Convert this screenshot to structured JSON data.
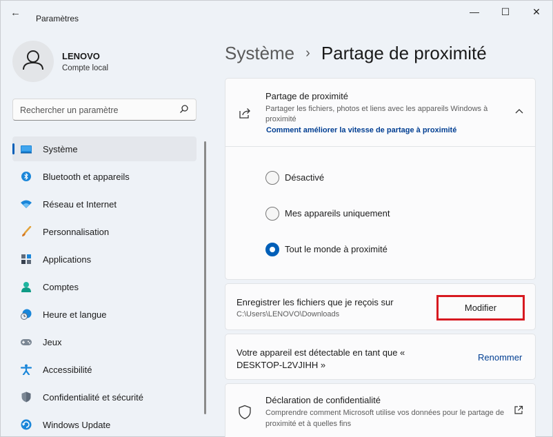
{
  "window": {
    "title": "Paramètres",
    "back_glyph": "←",
    "controls": {
      "minimize": "—",
      "maximize": "☐",
      "close": "✕"
    }
  },
  "profile": {
    "name": "LENOVO",
    "account_type": "Compte local",
    "icon": "user-avatar-icon"
  },
  "search": {
    "placeholder": "Rechercher un paramètre",
    "icon": "search-icon"
  },
  "sidebar": {
    "items": [
      {
        "label": "Système",
        "icon": "monitor-icon",
        "active": true
      },
      {
        "label": "Bluetooth et appareils",
        "icon": "bluetooth-icon"
      },
      {
        "label": "Réseau et Internet",
        "icon": "wifi-icon"
      },
      {
        "label": "Personnalisation",
        "icon": "brush-icon"
      },
      {
        "label": "Applications",
        "icon": "apps-icon"
      },
      {
        "label": "Comptes",
        "icon": "person-icon"
      },
      {
        "label": "Heure et langue",
        "icon": "clock-globe-icon"
      },
      {
        "label": "Jeux",
        "icon": "gamepad-icon"
      },
      {
        "label": "Accessibilité",
        "icon": "accessibility-icon"
      },
      {
        "label": "Confidentialité et sécurité",
        "icon": "shield-icon"
      },
      {
        "label": "Windows Update",
        "icon": "update-icon"
      }
    ]
  },
  "breadcrumb": {
    "parent": "Système",
    "separator": "›",
    "current": "Partage de proximité"
  },
  "nearby_card": {
    "title": "Partage de proximité",
    "description": "Partager les fichiers, photos et liens avec les appareils Windows à proximité",
    "link": "Comment améliorer la vitesse de partage à proximité",
    "options": [
      {
        "label": "Désactivé",
        "checked": false
      },
      {
        "label": "Mes appareils uniquement",
        "checked": false
      },
      {
        "label": "Tout le monde à proximité",
        "checked": true
      }
    ]
  },
  "save_card": {
    "title": "Enregistrer les fichiers que je reçois sur",
    "path": "C:\\Users\\LENOVO\\Downloads",
    "button": "Modifier"
  },
  "device_card": {
    "text": "Votre appareil est détectable en tant que « DESKTOP-L2VJIHH »",
    "action": "Renommer"
  },
  "privacy_card": {
    "title": "Déclaration de confidentialité",
    "description": "Comprendre comment Microsoft utilise vos données pour le partage de proximité et à quelles fins"
  },
  "colors": {
    "accent": "#005fb8",
    "link": "#003e92",
    "highlight_border": "#d71920"
  }
}
